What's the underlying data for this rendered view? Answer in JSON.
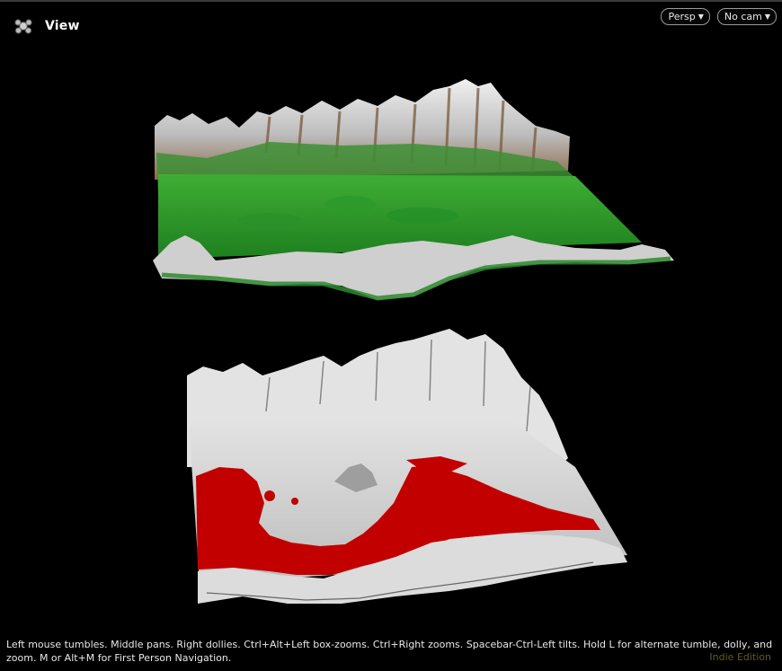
{
  "viewport": {
    "title": "View",
    "title_icon": "view-cluster-icon"
  },
  "camera_controls": {
    "projection": {
      "label": "Persp",
      "icon": "chevron-down-icon"
    },
    "camera": {
      "label": "No cam",
      "icon": "chevron-down-icon"
    }
  },
  "scene": {
    "objects": [
      {
        "id": "terrain-colored",
        "colors": {
          "lowland": "#2f9a2a",
          "slope": "#8a6a4a",
          "peak": "#e6e6e6"
        }
      },
      {
        "id": "terrain-mask",
        "colors": {
          "surface": "#d2d2d2",
          "mask": "#c20000"
        }
      }
    ]
  },
  "status": {
    "hint": "Left mouse tumbles. Middle pans. Right dollies. Ctrl+Alt+Left box-zooms. Ctrl+Right zooms. Spacebar-Ctrl-Left tilts. Hold L for alternate tumble, dolly, and zoom. M or Alt+M for First Person Navigation.",
    "edition": "Indie Edition"
  }
}
